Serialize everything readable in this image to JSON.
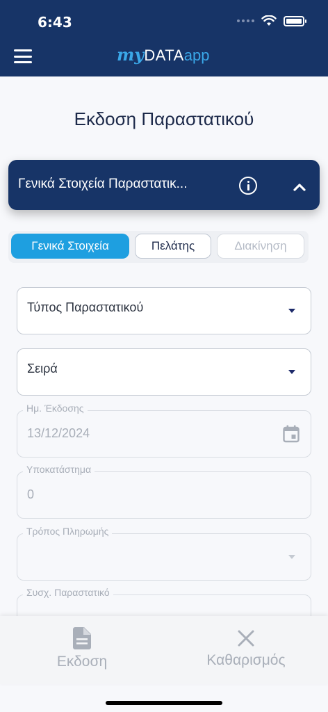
{
  "status": {
    "time": "6:43"
  },
  "app": {
    "logo_my": "my",
    "logo_data": "DATA",
    "logo_app": "app"
  },
  "page": {
    "title": "Εκδοση Παραστατικού"
  },
  "section": {
    "title": "Γενικά Στοιχεία Παραστατικ..."
  },
  "tabs": [
    {
      "label": "Γενικά Στοιχεία",
      "state": "selected"
    },
    {
      "label": "Πελάτης",
      "state": "enabled"
    },
    {
      "label": "Διακίνηση",
      "state": "disabled"
    }
  ],
  "fields": {
    "doc_type": {
      "value": "Τύπος Παραστατικού"
    },
    "series": {
      "value": "Σειρά"
    },
    "issue_date": {
      "label": "Ημ. Έκδοσης",
      "value": "13/12/2024"
    },
    "branch": {
      "label": "Υποκατάστημα",
      "value": "0"
    },
    "payment": {
      "label": "Τρόπος Πληρωμής",
      "value": ""
    },
    "related": {
      "label": "Συσχ. Παραστατικό"
    }
  },
  "bottom": {
    "issue_label": "Εκδοση",
    "clear_label": "Καθαρισμός"
  },
  "colors": {
    "primary": "#173467",
    "accent": "#1e9fe0",
    "muted": "#a9afb9"
  }
}
